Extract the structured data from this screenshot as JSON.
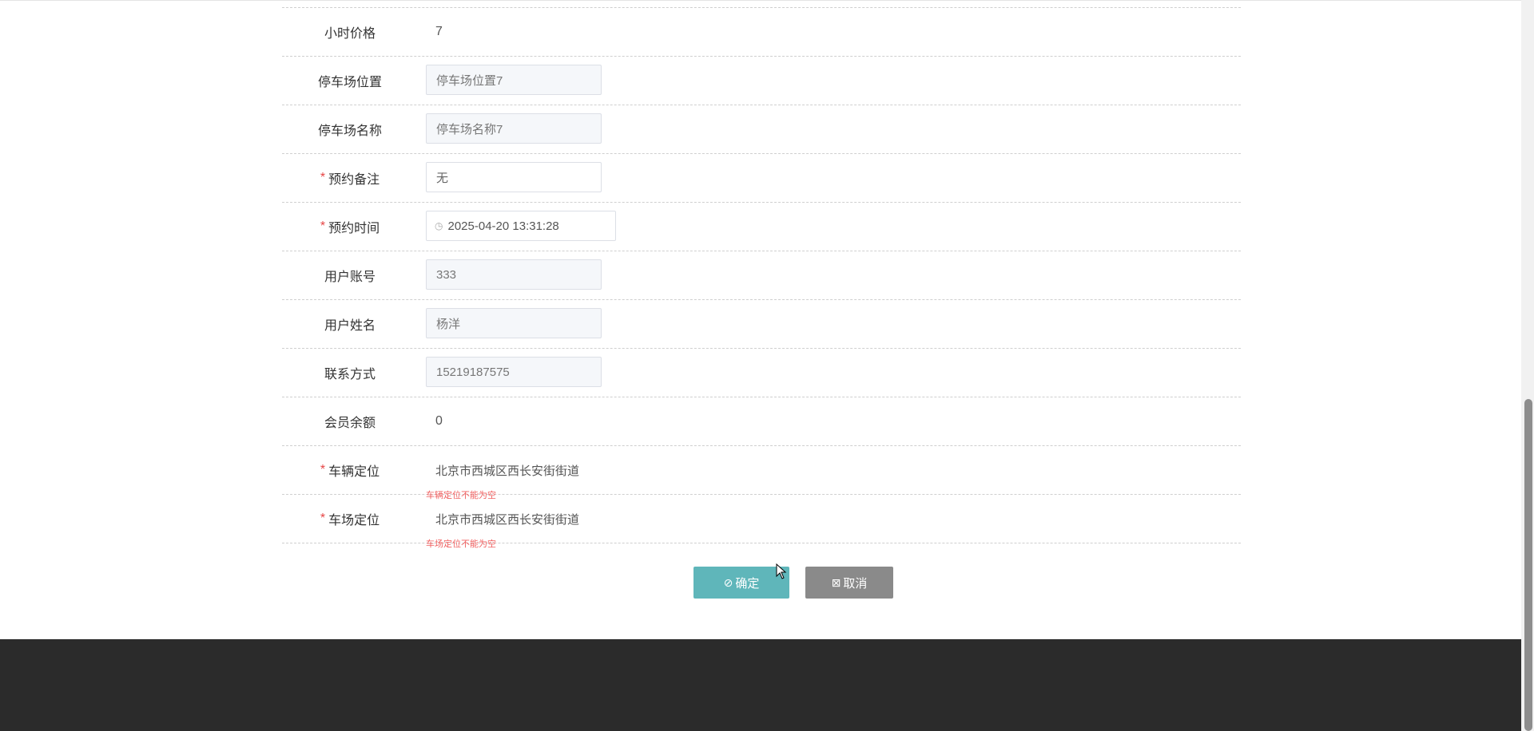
{
  "form": {
    "hourly_price": {
      "label": "小时价格",
      "value": "7"
    },
    "parking_location": {
      "label": "停车场位置",
      "value": "停车场位置7"
    },
    "parking_name": {
      "label": "停车场名称",
      "value": "停车场名称7"
    },
    "booking_note": {
      "required_mark": "*",
      "label": "预约备注",
      "value": "无"
    },
    "booking_time": {
      "required_mark": "*",
      "label": "预约时间",
      "value": "2025-04-20 13:31:28",
      "icon": "clock-icon"
    },
    "user_account": {
      "label": "用户账号",
      "value": "333"
    },
    "user_name": {
      "label": "用户姓名",
      "value": "杨洋"
    },
    "contact": {
      "label": "联系方式",
      "value": "15219187575"
    },
    "member_balance": {
      "label": "会员余额",
      "value": "0"
    },
    "vehicle_location": {
      "required_mark": "*",
      "label": "车辆定位",
      "value": "北京市西城区西长安街街道",
      "error": "车辆定位不能为空"
    },
    "lot_location": {
      "required_mark": "*",
      "label": "车场定位",
      "value": "北京市西城区西长安街街道",
      "error": "车场定位不能为空"
    }
  },
  "actions": {
    "confirm": {
      "icon": "⊘",
      "label": "确定"
    },
    "cancel": {
      "icon": "⊠",
      "label": "取消"
    }
  },
  "colors": {
    "confirm_button": "#5fb6ba",
    "cancel_button": "#8a8a8a",
    "required": "#e64545",
    "error_text": "#f06060",
    "footer": "#2b2b2b"
  }
}
